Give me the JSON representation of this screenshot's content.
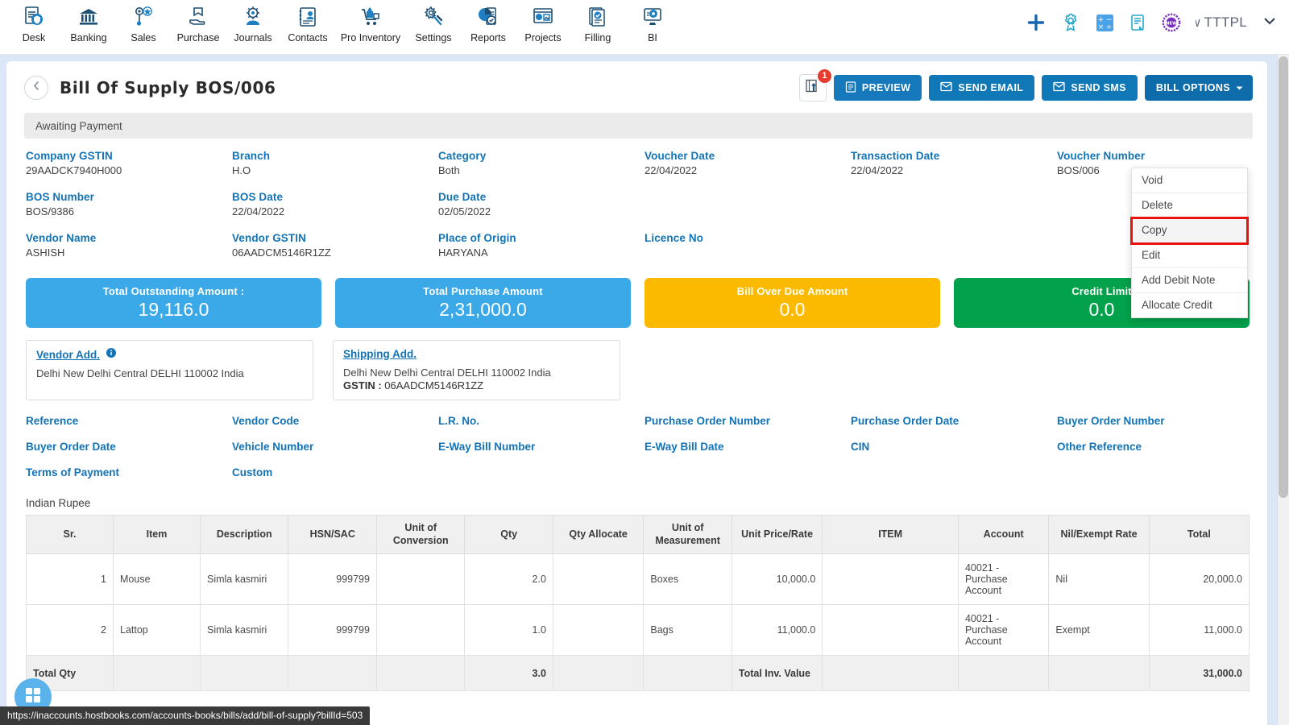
{
  "topnav": {
    "items": [
      {
        "label": "Desk",
        "icon": "desk-icon"
      },
      {
        "label": "Banking",
        "icon": "bank-icon"
      },
      {
        "label": "Sales",
        "icon": "sales-icon"
      },
      {
        "label": "Purchase",
        "icon": "purchase-icon"
      },
      {
        "label": "Journals",
        "icon": "journals-icon"
      },
      {
        "label": "Contacts",
        "icon": "contacts-icon"
      },
      {
        "label": "Pro Inventory",
        "icon": "inventory-icon"
      },
      {
        "label": "Settings",
        "icon": "settings-gear-icon"
      },
      {
        "label": "Reports",
        "icon": "reports-icon"
      },
      {
        "label": "Projects",
        "icon": "projects-icon"
      },
      {
        "label": "Filling",
        "icon": "filling-icon"
      },
      {
        "label": "BI",
        "icon": "bi-icon"
      }
    ],
    "right": {
      "add_icon": "plus-icon",
      "settings_icon": "gear-icon",
      "calculator_icon": "calculator-icon",
      "notes_icon": "notes-icon",
      "new_badge_icon": "new-badge-icon",
      "org_name": "ew TTTPL",
      "caret_icon": "chevron-down-icon"
    }
  },
  "header": {
    "back_icon": "chevron-left-icon",
    "title": "Bill Of Supply BOS/006",
    "upload_icon": "upload-icon",
    "upload_badge": "1",
    "preview_label": "PREVIEW",
    "send_email_label": "SEND EMAIL",
    "send_sms_label": "SEND SMS",
    "bill_options_label": "BILL OPTIONS"
  },
  "bill_options_menu": {
    "items": [
      {
        "label": "Void",
        "highlighted": false
      },
      {
        "label": "Delete",
        "highlighted": false
      },
      {
        "label": "Copy",
        "highlighted": true
      },
      {
        "label": "Edit",
        "highlighted": false
      },
      {
        "label": "Add Debit Note",
        "highlighted": false
      },
      {
        "label": "Allocate Credit",
        "highlighted": false
      }
    ]
  },
  "status": {
    "text": "Awaiting Payment"
  },
  "details": {
    "row1": [
      {
        "label": "Company GSTIN",
        "value": "29AADCK7940H000"
      },
      {
        "label": "Branch",
        "value": "H.O"
      },
      {
        "label": "Category",
        "value": "Both"
      },
      {
        "label": "Voucher Date",
        "value": "22/04/2022"
      },
      {
        "label": "Transaction Date",
        "value": "22/04/2022"
      },
      {
        "label": "Voucher Number",
        "value": "BOS/006"
      }
    ],
    "row2": [
      {
        "label": "BOS Number",
        "value": "BOS/9386"
      },
      {
        "label": "BOS Date",
        "value": "22/04/2022"
      },
      {
        "label": "Due Date",
        "value": "02/05/2022"
      },
      {
        "label": "",
        "value": ""
      },
      {
        "label": "",
        "value": ""
      },
      {
        "label": "",
        "value": ""
      }
    ],
    "row3": [
      {
        "label": "Vendor Name",
        "value": "ASHISH"
      },
      {
        "label": "Vendor GSTIN",
        "value": "06AADCM5146R1ZZ"
      },
      {
        "label": "Place of Origin",
        "value": "HARYANA"
      },
      {
        "label": "Licence No",
        "value": ""
      },
      {
        "label": "",
        "value": ""
      },
      {
        "label": "",
        "value": ""
      }
    ]
  },
  "summary_cards": [
    {
      "title": "Total Outstanding Amount :",
      "value": "19,116.0",
      "color": "#3ba9e8"
    },
    {
      "title": "Total Purchase Amount",
      "value": "2,31,000.0",
      "color": "#3ba9e8"
    },
    {
      "title": "Bill Over Due Amount",
      "value": "0.0",
      "color": "#fbba00"
    },
    {
      "title": "Credit Limit",
      "value": "0.0",
      "color": "#02a14b"
    }
  ],
  "addresses": {
    "vendor": {
      "title": "Vendor Add.",
      "info_icon": "info-icon",
      "line": "Delhi New Delhi Central DELHI 110002 India"
    },
    "shipping": {
      "title": "Shipping Add.",
      "line": "Delhi New Delhi Central DELHI 110002 India",
      "gstin_label": "GSTIN :",
      "gstin_value": "06AADCM5146R1ZZ"
    }
  },
  "reference_fields": {
    "row1": [
      "Reference",
      "Vendor Code",
      "L.R. No.",
      "Purchase Order Number",
      "Purchase Order Date",
      "Buyer Order Number"
    ],
    "row2": [
      "Buyer Order Date",
      "Vehicle Number",
      "E-Way Bill Number",
      "E-Way Bill Date",
      "CIN",
      "Other Reference"
    ],
    "row3": [
      "Terms of Payment",
      "Custom",
      "",
      "",
      "",
      ""
    ]
  },
  "items_table": {
    "currency_label": "Indian Rupee",
    "columns": [
      "Sr.",
      "Item",
      "Description",
      "HSN/SAC",
      "Unit of Conversion",
      "Qty",
      "Qty Allocate",
      "Unit of Measurement",
      "Unit Price/Rate",
      "ITEM",
      "Account",
      "Nil/Exempt Rate",
      "Total"
    ],
    "rows": [
      {
        "sr": "1",
        "item": "Mouse",
        "description": "Simla kasmiri",
        "hsn": "999799",
        "unit_conversion": "",
        "qty": "2.0",
        "qty_allocate": "",
        "uom": "Boxes",
        "unit_price": "10,000.0",
        "item2": "",
        "account": "40021 - Purchase Account",
        "nil_exempt": "Nil",
        "total": "20,000.0"
      },
      {
        "sr": "2",
        "item": "Lattop",
        "description": "Simla kasmiri",
        "hsn": "999799",
        "unit_conversion": "",
        "qty": "1.0",
        "qty_allocate": "",
        "uom": "Bags",
        "unit_price": "11,000.0",
        "item2": "",
        "account": "40021 - Purchase Account",
        "nil_exempt": "Exempt",
        "total": "11,000.0"
      }
    ],
    "total_row": {
      "label": "Total Qty",
      "qty": "3.0",
      "inv_value_label": "Total Inv. Value",
      "total": "31,000.0"
    }
  },
  "fab": {
    "icon": "grid-widget-icon"
  },
  "status_bar": {
    "url": "https://inaccounts.hostbooks.com/accounts-books/bills/add/bill-of-supply?billId=503"
  }
}
